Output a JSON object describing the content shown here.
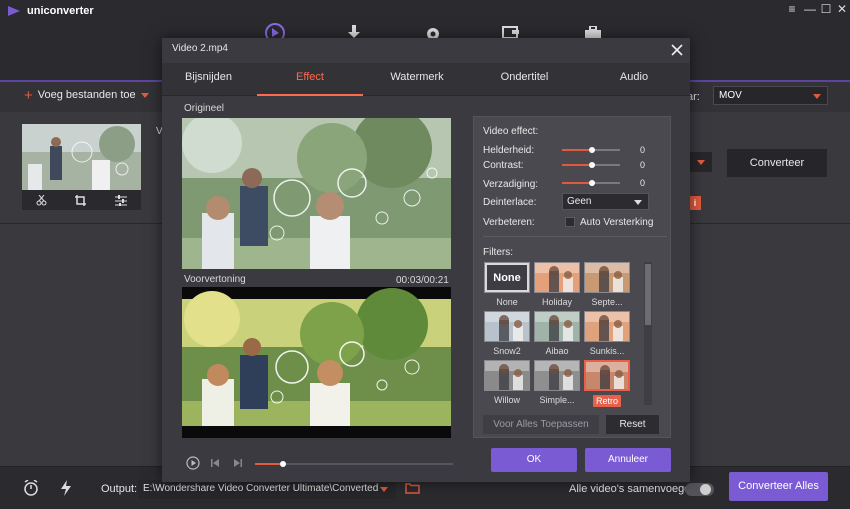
{
  "app": {
    "name": "uniconverter",
    "window_controls": [
      "≡",
      "—",
      "☐",
      "✕"
    ],
    "toolbar_icons": [
      "convert-icon",
      "download-icon",
      "record-icon",
      "transfer-icon",
      "toolbox-icon"
    ],
    "add_files_label": "Voeg bestanden toe",
    "format_label_partial": "ar:",
    "format_value": "MOV",
    "convert_label": "Converteer",
    "info_badge": "i",
    "partial_text": "V",
    "bottom": {
      "output_label": "Output:",
      "output_path": "E:\\Wondershare Video Converter Ultimate\\Converted",
      "merge_label": "Alle video's samenvoegen",
      "merge_enabled": false,
      "convert_all_label": "Converteer Alles"
    }
  },
  "dialog": {
    "title": "Video 2.mp4",
    "tabs": [
      "Bijsnijden",
      "Effect",
      "Watermerk",
      "Ondertitel",
      "Audio"
    ],
    "active_tab": "Effect",
    "original_label": "Origineel",
    "preview_label": "Voorvertoning",
    "time": "00:03/00:21",
    "playback_progress": 0.14,
    "panel": {
      "video_effect_label": "Video effect:",
      "controls": [
        {
          "label": "Helderheid:",
          "value": "0"
        },
        {
          "label": "Contrast:",
          "value": "0"
        },
        {
          "label": "Verzadiging:",
          "value": "0"
        }
      ],
      "deinterlace_label": "Deinterlace:",
      "deinterlace_value": "Geen",
      "improve_label": "Verbeteren:",
      "auto_enhance_label": "Auto Versterking",
      "auto_enhance_checked": false,
      "filters_label": "Filters:",
      "filters": [
        {
          "name": "None",
          "thumb_text": "None",
          "tint": "none"
        },
        {
          "name": "Holiday",
          "tint": "#e3a07a"
        },
        {
          "name": "Septe...",
          "tint": "#c79a73"
        },
        {
          "name": "Snow2",
          "tint": "#b7c2cc"
        },
        {
          "name": "Aibao",
          "tint": "#9fb3a8"
        },
        {
          "name": "Sunkis...",
          "tint": "#e0a27c"
        },
        {
          "name": "Willow",
          "tint": "#8a8a8a"
        },
        {
          "name": "Simple...",
          "tint": "#8f8f8f"
        },
        {
          "name": "Retro",
          "tint": "#c8866a"
        }
      ],
      "selected_filter": "Retro",
      "apply_all_label": "Voor Alles Toepassen",
      "reset_label": "Reset"
    },
    "ok_label": "OK",
    "cancel_label": "Annuleer"
  }
}
